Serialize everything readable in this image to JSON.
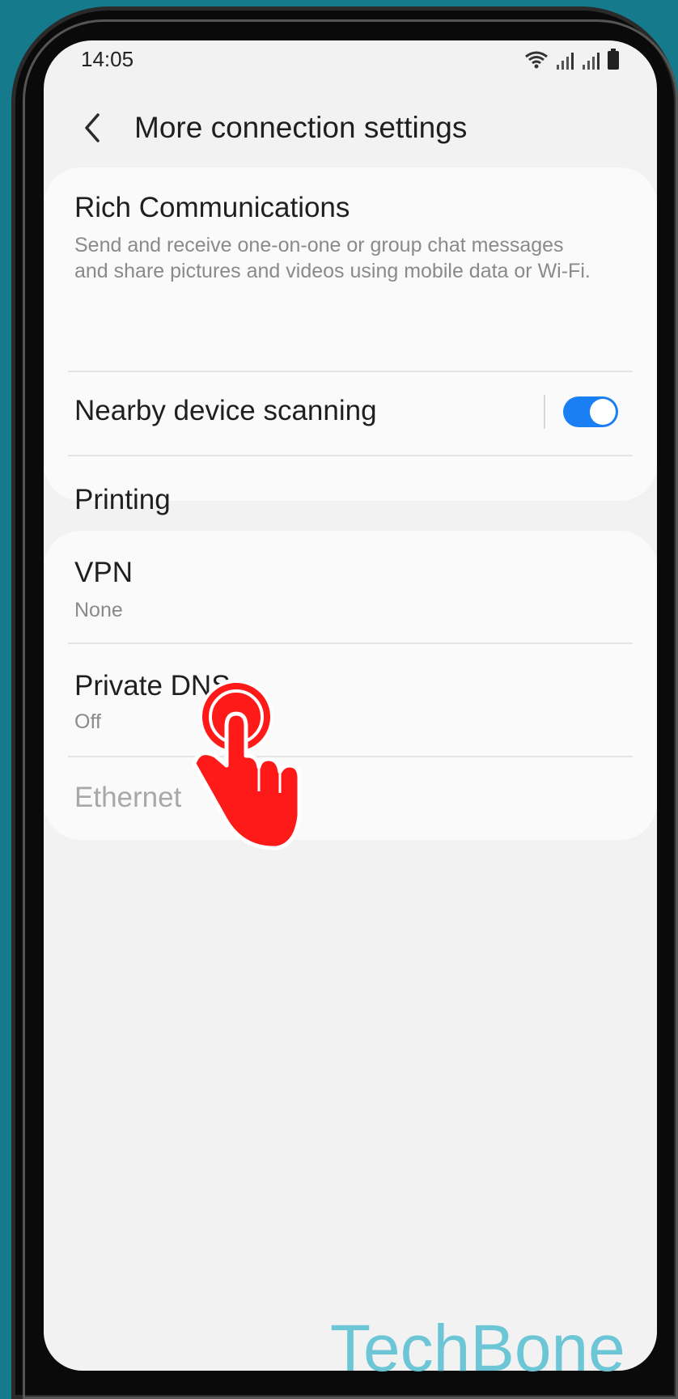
{
  "status_bar": {
    "time": "14:05",
    "icons": [
      "wifi-icon",
      "signal-icon",
      "signal-icon",
      "battery-icon"
    ]
  },
  "header": {
    "back_icon": "chevron-left-icon",
    "title": "More connection settings"
  },
  "sections": [
    {
      "items": [
        {
          "title": "Rich Communications",
          "subtitle": "Send and receive one-on-one or group chat messages and share pictures and videos using mobile data or Wi-Fi."
        },
        {
          "title": "Nearby device scanning",
          "toggle_on": true
        },
        {
          "title": "Printing"
        }
      ]
    },
    {
      "items": [
        {
          "title": "VPN",
          "subtitle": "None"
        },
        {
          "title": "Private DNS",
          "subtitle": "Off"
        },
        {
          "title": "Ethernet",
          "disabled": true
        }
      ]
    }
  ],
  "overlay": {
    "tap_indicator": "pointing-hand-icon",
    "tap_color": "#ff1a1a"
  },
  "watermark": "TechBone",
  "colors": {
    "accent": "#1a7ff2",
    "background": "#147a8c"
  }
}
